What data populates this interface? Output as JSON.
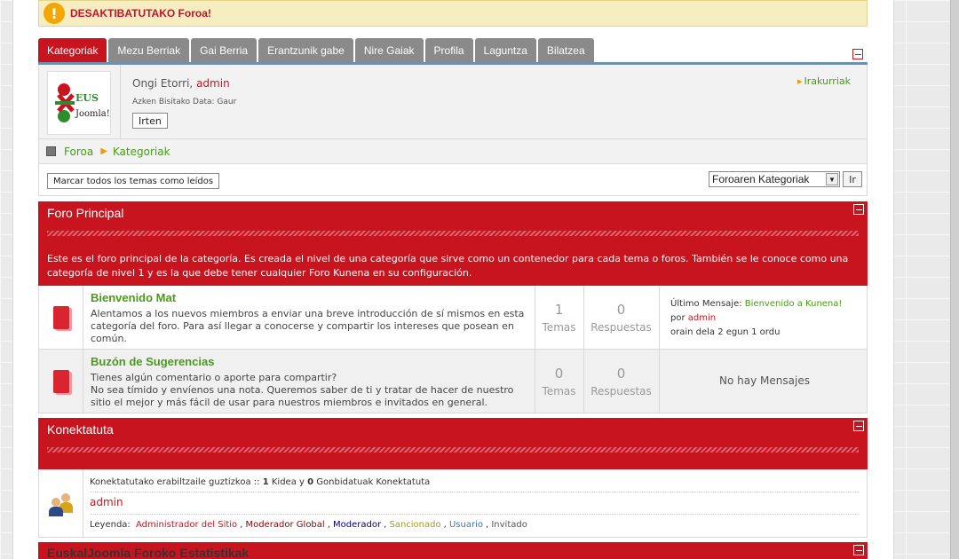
{
  "alert": {
    "text": "DESAKTIBATUTAKO Foroa!"
  },
  "tabs": [
    {
      "label": "Kategoriak"
    },
    {
      "label": "Mezu Berriak"
    },
    {
      "label": "Gai Berria"
    },
    {
      "label": "Erantzunik gabe"
    },
    {
      "label": "Nire Gaiak"
    },
    {
      "label": "Profila"
    },
    {
      "label": "Laguntza"
    },
    {
      "label": "Bilatzea"
    }
  ],
  "profile": {
    "welcome_prefix": "Ongi Etorri,",
    "username": "admin",
    "last_visit": "Azken Bisitako Data: Gaur",
    "logout_label": "Irten",
    "unread_link": "Irakurriak",
    "logo_text": "EUSKAL Joomla!"
  },
  "breadcrumb": {
    "home": "Foroa",
    "current": "Kategoriak"
  },
  "actions": {
    "mark_read_label": "Marcar todos los temas como leídos",
    "category_select": "Foroaren Kategoriak",
    "go_label": "Ir"
  },
  "category": {
    "title": "Foro Principal",
    "description": "Este es el foro principal de la categoría. Es creada el nivel de una categoría que sirve como un contenedor para cada tema o foros. También se le conoce como una categoría de nivel 1 y es la que debe tener cualquier Foro Kunena en su configuración."
  },
  "forums": [
    {
      "name": "Bienvenido Mat",
      "description": "Alentamos a los nuevos miembros a enviar una breve introducción de sí mismos en esta categoría del foro. Para así llegar a conocerse y compartir los intereses que posean en común.",
      "topics": "1",
      "topics_label": "Temas",
      "replies": "0",
      "replies_label": "Respuestas",
      "last_label": "Último Mensaje:",
      "last_title": "Bienvenido a Kunena!",
      "by_label": "por",
      "last_user": "admin",
      "last_time": "orain dela 2 egun 1 ordu"
    },
    {
      "name": "Buzón de Sugerencias",
      "description": "Tienes algún comentario o aporte para compartir?\nNo sea tímido y envíenos una nota. Queremos saber de ti y tratar de hacer de nuestro sitio el mejor y más fácil de usar para nuestros miembros e invitados en general.",
      "topics": "0",
      "topics_label": "Temas",
      "replies": "0",
      "replies_label": "Respuestas",
      "no_messages": "No hay Mensajes"
    }
  ],
  "online": {
    "title": "Konektatuta",
    "summary_prefix": "Konektatutako erabiltzaile guztizkoa ::",
    "members_count": "1",
    "members_label": "Kidea y",
    "guests_count": "0",
    "guests_label": "Gonbidatuak Konektatuta",
    "user": "admin",
    "legend_label": "Leyenda:",
    "legend": [
      {
        "label": "Administrador del Sitio",
        "color": "#c8141e"
      },
      {
        "label": "Moderador Global",
        "color": "#8b0000"
      },
      {
        "label": "Moderador",
        "color": "#000080"
      },
      {
        "label": "Sancionado",
        "color": "#a0a020"
      },
      {
        "label": "Usuario",
        "color": "#3a78b0"
      },
      {
        "label": "Invitado",
        "color": "#555555"
      }
    ]
  },
  "stats": {
    "title": "EuskalJoomla Foroko Estatistikak"
  },
  "colors": {
    "brand_red": "#c8141e",
    "link_green": "#4a9a1a",
    "tab_grey": "#8a8a8a"
  }
}
